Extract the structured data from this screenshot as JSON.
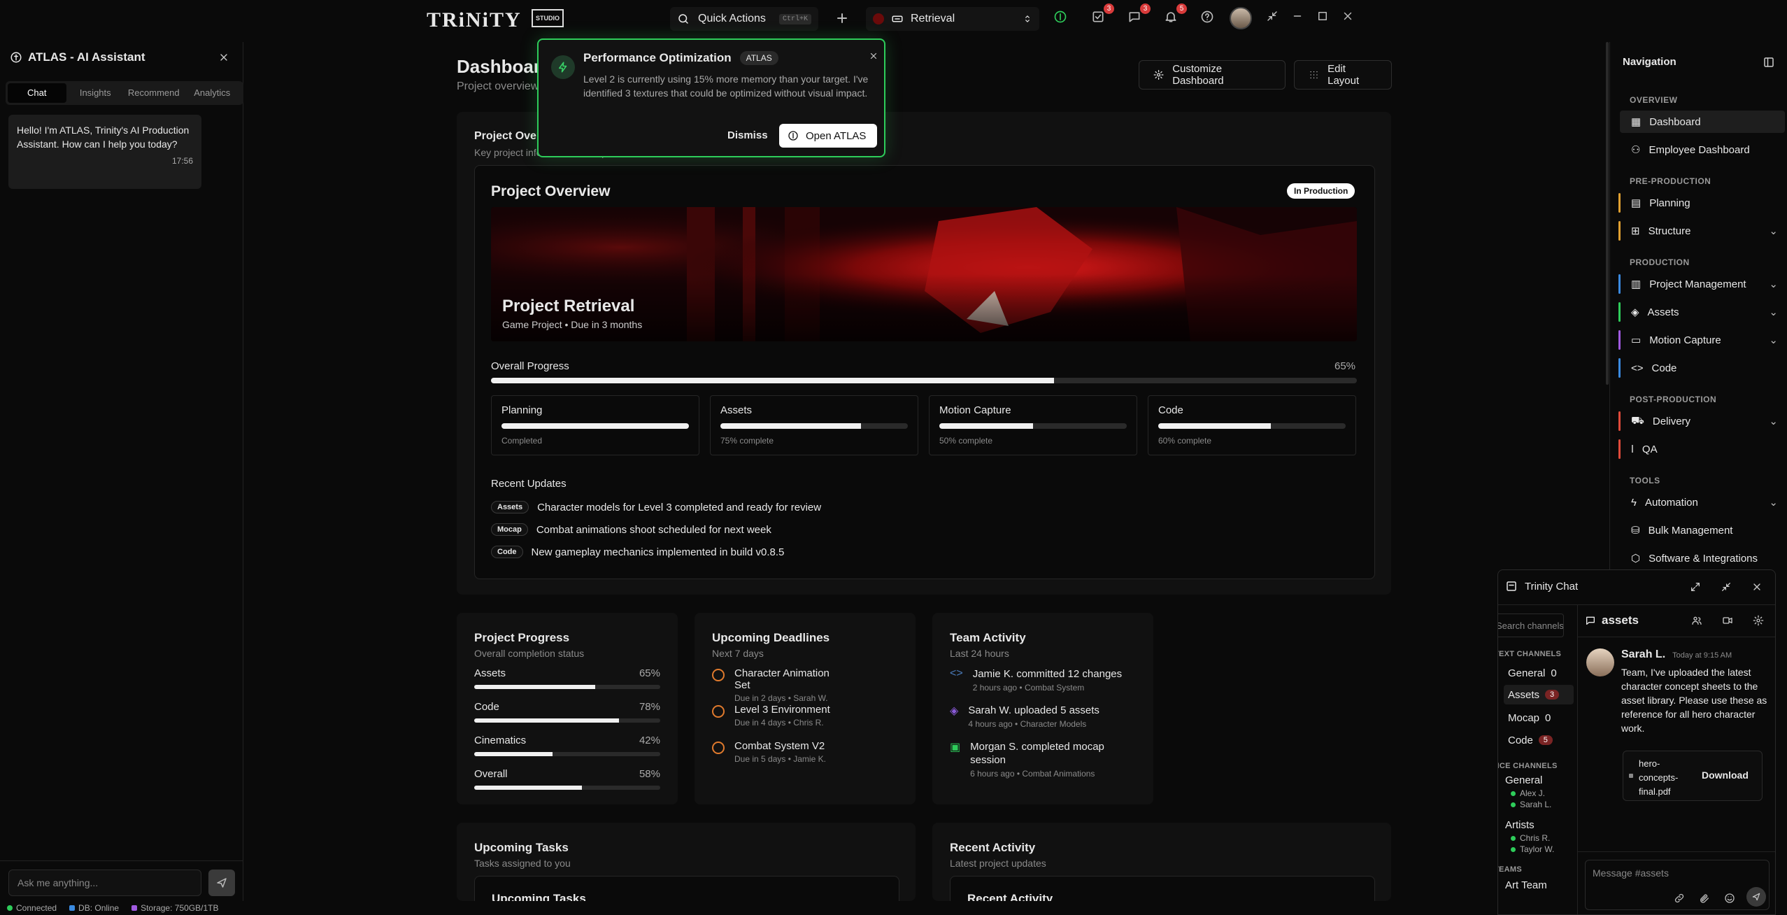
{
  "topbar": {
    "logo": "TRiNiTY",
    "logo2": "STUDIO",
    "quick_actions": "Quick Actions",
    "shortcut": "Ctrl+K",
    "project": "Retrieval",
    "badges": {
      "tasks": "3",
      "messages": "3",
      "notifications": "5"
    }
  },
  "assistant": {
    "title": "ATLAS - AI Assistant",
    "tabs": [
      "Chat",
      "Insights",
      "Recommend",
      "Analytics"
    ],
    "message": "Hello! I'm ATLAS, Trinity's AI Production Assistant. How can I help you today?",
    "message_time": "17:56",
    "input_placeholder": "Ask me anything..."
  },
  "status": {
    "connected": "Connected",
    "db": "DB: Online",
    "storage": "Storage: 750GB/1TB"
  },
  "header": {
    "title": "Dashboard",
    "subtitle": "Project overview",
    "customize": "Customize Dashboard",
    "edit_layout": "Edit Layout"
  },
  "popup": {
    "title": "Performance Optimization",
    "tag": "ATLAS",
    "body": "Level 2 is currently using 15% more memory than your target. I've identified 3 textures that could be optimized without visual impact.",
    "dismiss": "Dismiss",
    "open": "Open ATLAS"
  },
  "overview_card": {
    "title": "Project Overview",
    "subtitle": "Key project information and updates"
  },
  "overview": {
    "title": "Project Overview",
    "status": "In Production",
    "project_name": "Project Retrieval",
    "project_meta": "Game Project • Due in 3 months",
    "progress_label": "Overall Progress",
    "progress_value": "65%",
    "progress": 0.65,
    "stages": [
      {
        "name": "Planning",
        "status": "Completed",
        "progress": 1.0
      },
      {
        "name": "Assets",
        "status": "75% complete",
        "progress": 0.75
      },
      {
        "name": "Motion Capture",
        "status": "50% complete",
        "progress": 0.5
      },
      {
        "name": "Code",
        "status": "60% complete",
        "progress": 0.6
      }
    ],
    "updates_title": "Recent Updates",
    "updates": [
      {
        "tag": "Assets",
        "text": "Character models for Level 3 completed and ready for review"
      },
      {
        "tag": "Mocap",
        "text": "Combat animations shoot scheduled for next week"
      },
      {
        "tag": "Code",
        "text": "New gameplay mechanics implemented in build v0.8.5"
      }
    ]
  },
  "project_progress": {
    "title": "Project Progress",
    "subtitle": "Overall completion status",
    "rows": [
      {
        "label": "Assets",
        "value": "65%",
        "progress": 0.65
      },
      {
        "label": "Code",
        "value": "78%",
        "progress": 0.78
      },
      {
        "label": "Cinematics",
        "value": "42%",
        "progress": 0.42
      },
      {
        "label": "Overall",
        "value": "58%",
        "progress": 0.58
      }
    ]
  },
  "deadlines": {
    "title": "Upcoming Deadlines",
    "subtitle": "Next 7 days",
    "items": [
      {
        "title": "Character Animation Set",
        "meta": "Due in 2 days • Sarah W."
      },
      {
        "title": "Level 3 Environment",
        "meta": "Due in 4 days • Chris R."
      },
      {
        "title": "Combat System V2",
        "meta": "Due in 5 days • Jamie K."
      }
    ]
  },
  "team_activity": {
    "title": "Team Activity",
    "subtitle": "Last 24 hours",
    "items": [
      {
        "title": "Jamie K. committed 12 changes",
        "meta": "2 hours ago • Combat System",
        "color": "#4a7ab8"
      },
      {
        "title": "Sarah W. uploaded 5 assets",
        "meta": "4 hours ago • Character Models",
        "color": "#8a5ad8"
      },
      {
        "title": "Morgan S. completed mocap session",
        "meta": "6 hours ago • Combat Animations",
        "color": "#2ecc5a"
      }
    ]
  },
  "upcoming_tasks": {
    "title": "Upcoming Tasks",
    "subtitle": "Tasks assigned to you",
    "inner_title": "Upcoming Tasks"
  },
  "recent_activity": {
    "title": "Recent Activity",
    "subtitle": "Latest project updates",
    "inner_title": "Recent Activity"
  },
  "nav": {
    "title": "Navigation",
    "sections": {
      "overview": "OVERVIEW",
      "pre": "PRE-PRODUCTION",
      "prod": "PRODUCTION",
      "post": "POST-PRODUCTION",
      "tools": "TOOLS"
    },
    "items": {
      "dashboard": "Dashboard",
      "employee": "Employee Dashboard",
      "planning": "Planning",
      "structure": "Structure",
      "pm": "Project Management",
      "assets": "Assets",
      "mocap": "Motion Capture",
      "code": "Code",
      "delivery": "Delivery",
      "qa": "QA",
      "automation": "Automation",
      "bulk": "Bulk Management",
      "software": "Software & Integrations"
    },
    "colors": {
      "pre": "#e0a030",
      "prod_pm": "#3a8ae0",
      "prod_assets": "#2ecc5a",
      "prod_mocap": "#a05ae0",
      "prod_code": "#3a8ae0",
      "post": "#e04a3a"
    }
  },
  "chat": {
    "title": "Trinity Chat",
    "search": "Search channels...",
    "text_channels": "TEXT CHANNELS",
    "channels": [
      {
        "name": "General",
        "count": "0"
      },
      {
        "name": "Assets",
        "count": "3"
      },
      {
        "name": "Mocap",
        "count": "0"
      },
      {
        "name": "Code",
        "count": "5"
      }
    ],
    "voice_channels": "VOICE CHANNELS",
    "voice": [
      {
        "name": "General",
        "users": [
          "Alex J.",
          "Sarah L."
        ]
      },
      {
        "name": "Artists",
        "users": [
          "Chris R.",
          "Taylor W."
        ]
      }
    ],
    "teams": "TEAMS",
    "team": "Art Team",
    "channel": "assets",
    "author": "Sarah L.",
    "time": "Today at 9:15 AM",
    "message": "Team, I've uploaded the latest character concept sheets to the asset library. Please use these as reference for all hero character work.",
    "file": "hero-concepts-final.pdf",
    "download": "Download",
    "placeholder": "Message #assets"
  }
}
